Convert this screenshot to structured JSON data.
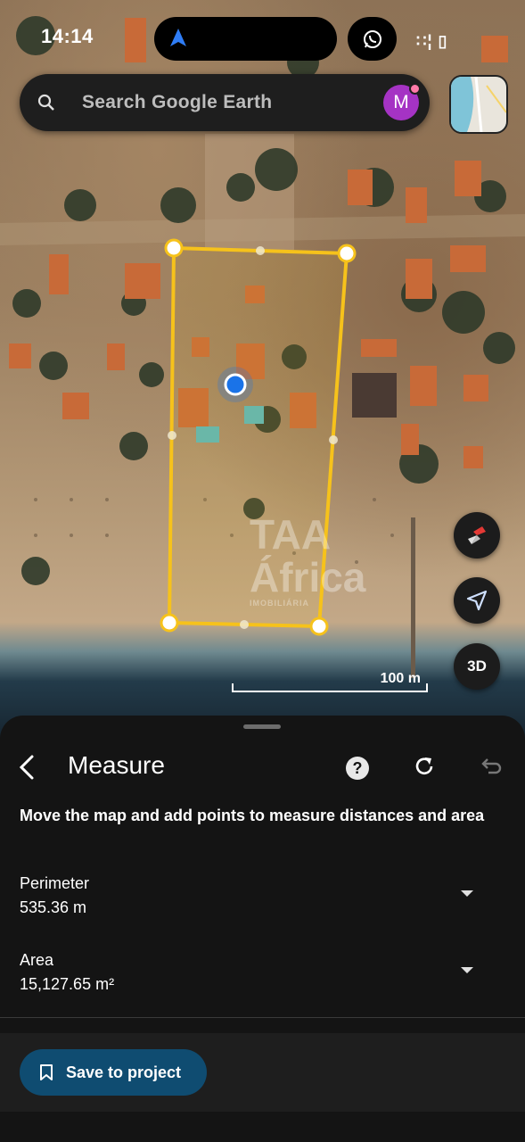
{
  "status_bar": {
    "time": "14:14"
  },
  "search": {
    "placeholder": "Search Google Earth"
  },
  "account": {
    "initial": "M"
  },
  "map": {
    "scale_label": "100 m",
    "watermark_line1": "TAA",
    "watermark_line2": "África",
    "watermark_sub": "IMOBILIÁRIA",
    "three_d_label": "3D"
  },
  "measure": {
    "title": "Measure",
    "instruction": "Move the map and add points to measure distances and area",
    "perimeter_label": "Perimeter",
    "perimeter_value": "535.36 m",
    "area_label": "Area",
    "area_value": "15,127.65 m²",
    "save_label": "Save to project"
  },
  "colors": {
    "polygon": "#f6c21b",
    "location_dot": "#1a73e8",
    "save_button": "#0f4c71",
    "avatar": "#a533c4"
  }
}
